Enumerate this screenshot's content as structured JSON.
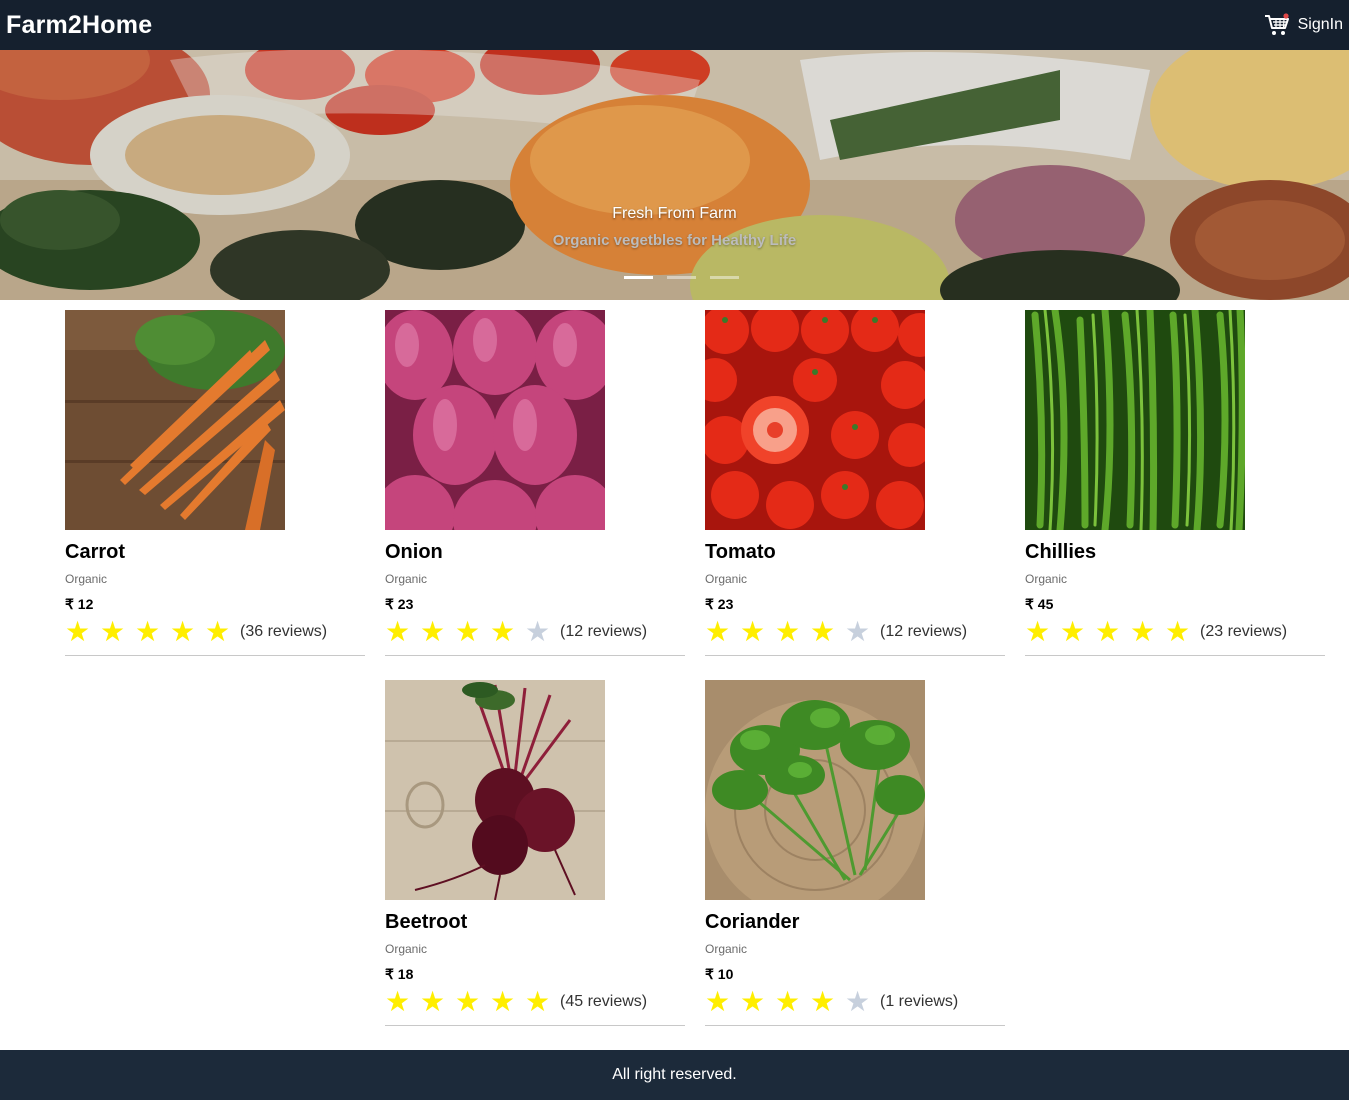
{
  "navbar": {
    "brand": "Farm2Home",
    "signin_label": "SignIn",
    "cart_icon": "shopping-cart-icon"
  },
  "carousel": {
    "title": "Fresh From Farm",
    "subtitle": "Organic vegetbles for Healthy Life",
    "slide_count": 3,
    "active_slide": 1
  },
  "products": [
    {
      "name": "Carrot",
      "tag": "Organic",
      "price": "₹ 12",
      "rating": 5,
      "reviews": "(36 reviews)"
    },
    {
      "name": "Onion",
      "tag": "Organic",
      "price": "₹ 23",
      "rating": 4,
      "reviews": "(12 reviews)"
    },
    {
      "name": "Tomato",
      "tag": "Organic",
      "price": "₹ 23",
      "rating": 4,
      "reviews": "(12 reviews)"
    },
    {
      "name": "Chillies",
      "tag": "Organic",
      "price": "₹ 45",
      "rating": 5,
      "reviews": "(23 reviews)"
    },
    {
      "name": "Beetroot",
      "tag": "Organic",
      "price": "₹ 18",
      "rating": 5,
      "reviews": "(45 reviews)"
    },
    {
      "name": "Coriander",
      "tag": "Organic",
      "price": "₹ 10",
      "rating": 4,
      "reviews": "(1 reviews)"
    }
  ],
  "colors": {
    "navbar_bg": "#15202e",
    "footer_bg": "#1c2a3a",
    "star_filled": "#ffee00",
    "star_empty": "#c7d0dd"
  },
  "footer": {
    "text": "All right reserved."
  }
}
